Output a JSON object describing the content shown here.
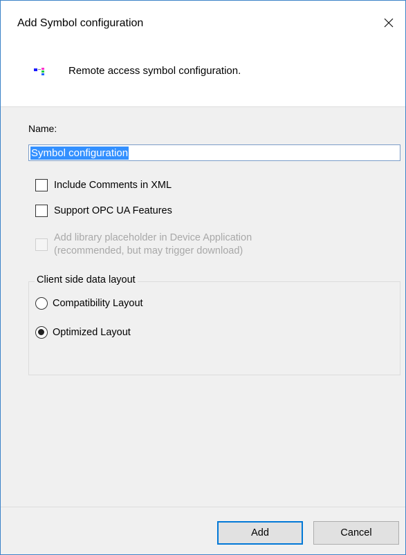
{
  "window": {
    "title": "Add Symbol configuration"
  },
  "header": {
    "icon": "symbol-config-icon",
    "description": "Remote access symbol configuration."
  },
  "form": {
    "name_label": "Name:",
    "name_value": "Symbol configuration",
    "checkboxes": [
      {
        "label": "Include Comments in XML",
        "checked": false,
        "enabled": true
      },
      {
        "label": "Support OPC UA Features",
        "checked": false,
        "enabled": true
      },
      {
        "label_line1": "Add library placeholder in Device Application",
        "label_line2": "(recommended, but may trigger download)",
        "checked": false,
        "enabled": false
      }
    ],
    "layout_group": {
      "title": "Client side data layout",
      "options": [
        {
          "label": "Compatibility Layout",
          "selected": false
        },
        {
          "label": "Optimized Layout",
          "selected": true
        }
      ]
    }
  },
  "buttons": {
    "add_label": "Add",
    "cancel_label": "Cancel"
  },
  "colors": {
    "accent": "#0078d7",
    "selection": "#3390ff",
    "window_border": "#3b82c8",
    "disabled_text": "#a8a8a8"
  }
}
